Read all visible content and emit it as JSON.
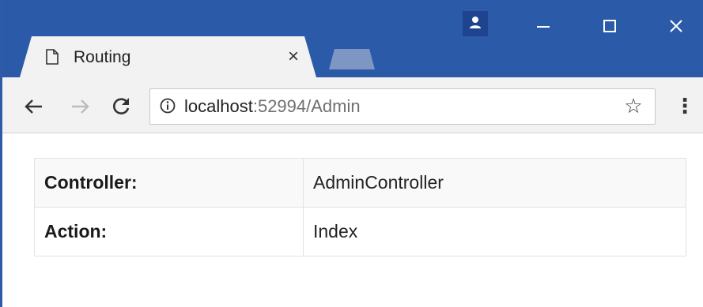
{
  "browser": {
    "tab_title": "Routing",
    "tab_close": "×",
    "icons": {
      "tab": "document-icon",
      "profile": "person-icon",
      "back": "arrow-left-icon",
      "forward": "arrow-right-icon",
      "reload": "reload-icon",
      "info": "info-icon",
      "bookmark": "star-icon",
      "menu": "vertical-dots-icon"
    },
    "url_host": "localhost",
    "url_rest": ":52994/Admin",
    "colors": {
      "titlebar": "#2b5ba8",
      "toolbar": "#f2f2f2"
    }
  },
  "page": {
    "rows": [
      {
        "label": "Controller:",
        "value": "AdminController"
      },
      {
        "label": "Action:",
        "value": "Index"
      }
    ]
  }
}
